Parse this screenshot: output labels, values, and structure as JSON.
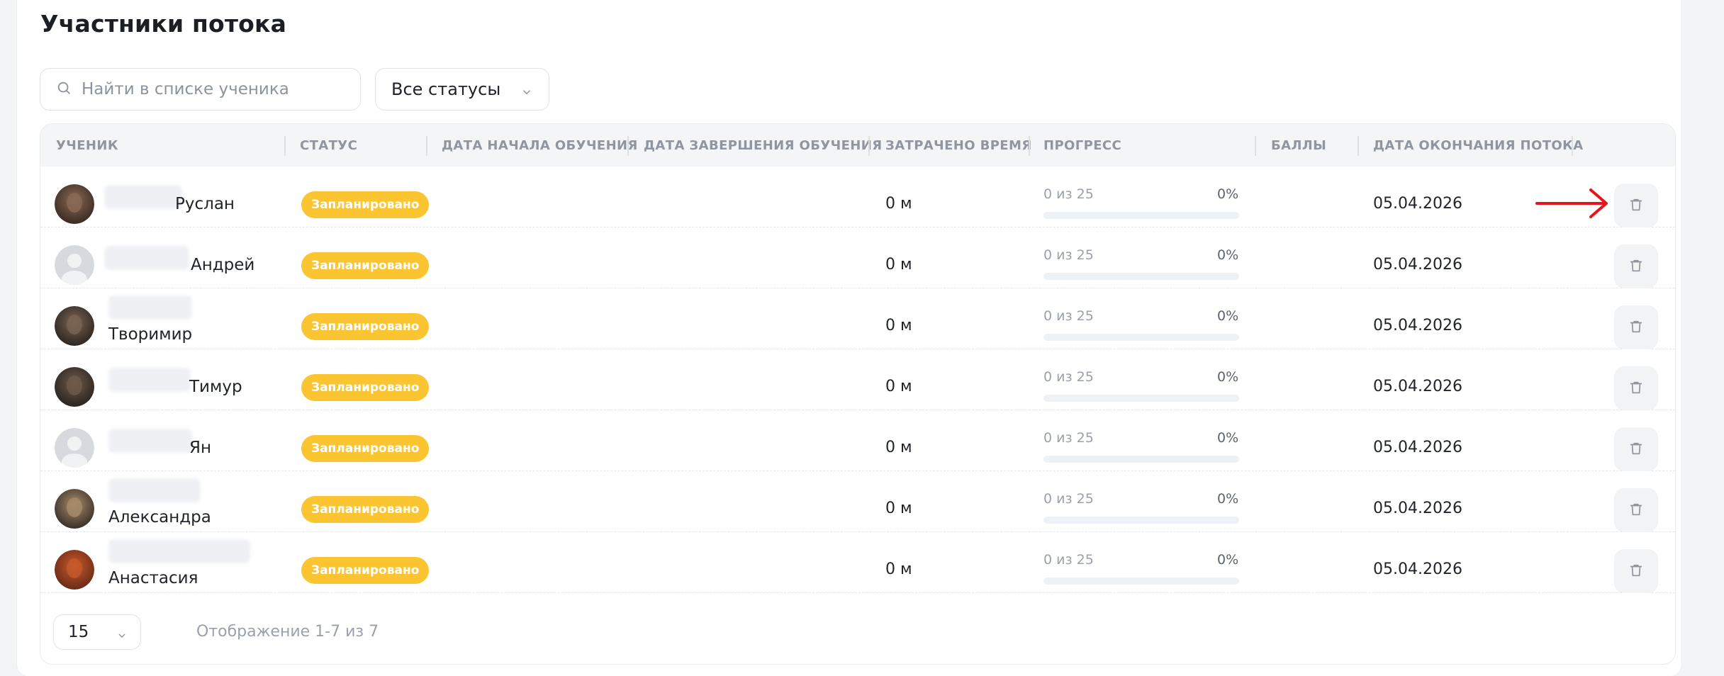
{
  "page": {
    "title": "Участники потока"
  },
  "search": {
    "placeholder": "Найти в списке ученика"
  },
  "status_filter": {
    "selected": "Все статусы"
  },
  "table": {
    "columns": [
      {
        "key": "student",
        "label": "Ученик"
      },
      {
        "key": "status",
        "label": "Статус"
      },
      {
        "key": "start",
        "label": "Дата начала обучения"
      },
      {
        "key": "end",
        "label": "Дата завершения обучения"
      },
      {
        "key": "time",
        "label": "Затрачено время"
      },
      {
        "key": "progress",
        "label": "Прогресс"
      },
      {
        "key": "score",
        "label": "Баллы"
      },
      {
        "key": "stream_end",
        "label": "Дата окончания потока"
      }
    ],
    "rows": [
      {
        "name": "Руслан",
        "avatar": "photo",
        "status": "Запланировано",
        "time": "0 м",
        "progress_text": "0 из 25",
        "progress_pct": "0%",
        "progress_value": 0,
        "stream_end": "05.04.2026"
      },
      {
        "name": "Андрей",
        "avatar": "placeholder",
        "status": "Запланировано",
        "time": "0 м",
        "progress_text": "0 из 25",
        "progress_pct": "0%",
        "progress_value": 0,
        "stream_end": "05.04.2026"
      },
      {
        "name": "Творимир",
        "avatar": "photo",
        "status": "Запланировано",
        "time": "0 м",
        "progress_text": "0 из 25",
        "progress_pct": "0%",
        "progress_value": 0,
        "stream_end": "05.04.2026"
      },
      {
        "name": "Тимур",
        "avatar": "photo",
        "status": "Запланировано",
        "time": "0 м",
        "progress_text": "0 из 25",
        "progress_pct": "0%",
        "progress_value": 0,
        "stream_end": "05.04.2026"
      },
      {
        "name": "Ян",
        "avatar": "placeholder",
        "status": "Запланировано",
        "time": "0 м",
        "progress_text": "0 из 25",
        "progress_pct": "0%",
        "progress_value": 0,
        "stream_end": "05.04.2026"
      },
      {
        "name": "Александра",
        "avatar": "photo",
        "status": "Запланировано",
        "time": "0 м",
        "progress_text": "0 из 25",
        "progress_pct": "0%",
        "progress_value": 0,
        "stream_end": "05.04.2026"
      },
      {
        "name": "Анастасия",
        "avatar": "photo",
        "status": "Запланировано",
        "time": "0 м",
        "progress_text": "0 из 25",
        "progress_pct": "0%",
        "progress_value": 0,
        "stream_end": "05.04.2026"
      }
    ]
  },
  "pagination": {
    "per_page": "15",
    "summary": "Отображение 1-7 из 7"
  },
  "colors": {
    "badge": "#fbc531",
    "annotation_arrow": "#e8141b"
  },
  "icons": {
    "search": "search-icon",
    "chevron": "chevron-down-icon",
    "trash": "trash-icon",
    "arrow": "arrow-right-icon"
  }
}
